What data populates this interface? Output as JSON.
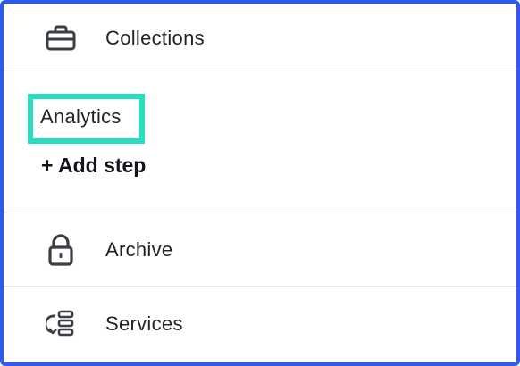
{
  "menu": {
    "collections": {
      "label": "Collections",
      "icon": "briefcase-icon"
    },
    "archive": {
      "label": "Archive",
      "icon": "lock-icon"
    },
    "services": {
      "label": "Services",
      "icon": "services-stack-icon"
    }
  },
  "section": {
    "highlighted_label": "Analytics",
    "add_step_label": "+ Add step"
  },
  "colors": {
    "frame_border": "#2f5bea",
    "highlight": "#24e0c1",
    "divider": "#e3e5e8",
    "text": "#1f2328"
  }
}
